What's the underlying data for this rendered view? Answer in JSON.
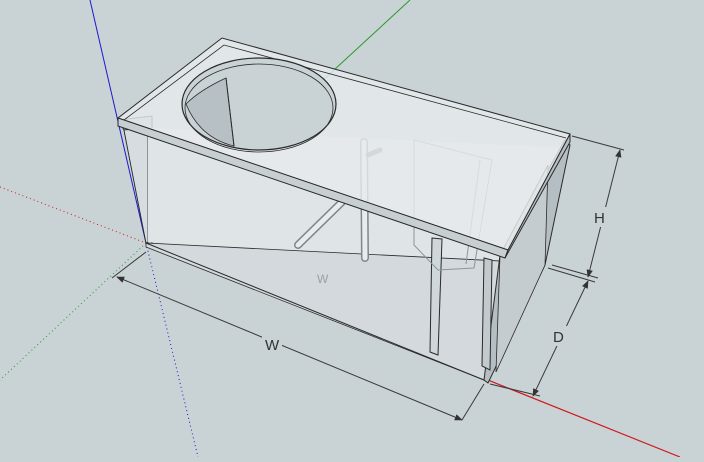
{
  "viewport": {
    "background": "#c9d2d5",
    "axes": {
      "red": "#d11919",
      "green": "#2a9a2a",
      "blue": "#1a1ad0"
    }
  },
  "model": {
    "name": "subwoofer-box",
    "has_port_slot": true,
    "has_speaker_cutout": true,
    "has_internal_braces": true
  },
  "dimensions": {
    "width_label": "W",
    "height_label": "H",
    "depth_label": "D",
    "inner_width_label": "W"
  },
  "colors": {
    "face_light": "#e6eaec",
    "face_mid": "#d6dcdf",
    "face_dark": "#b9c2c6",
    "edge": "#2a2a2a",
    "hidden_edge": "#8e969a",
    "dim_line": "#3a3a3a"
  }
}
